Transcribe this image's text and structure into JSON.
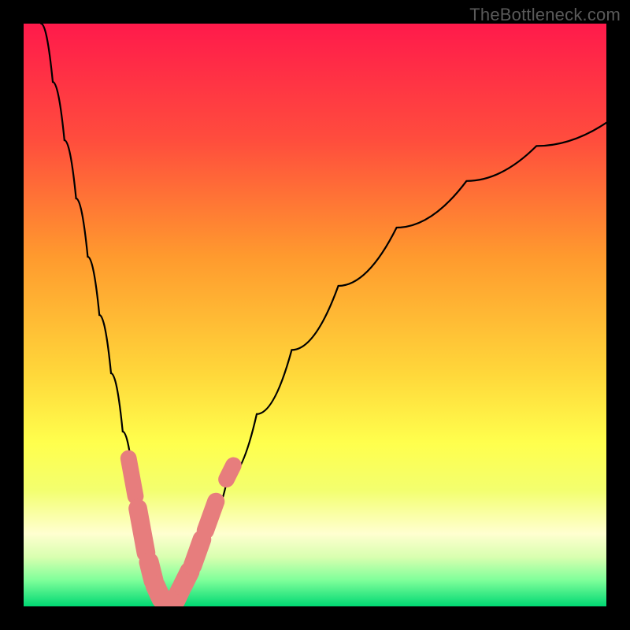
{
  "watermark": "TheBottleneck.com",
  "chart_data": {
    "type": "line",
    "title": "",
    "xlabel": "",
    "ylabel": "",
    "xlim": [
      0,
      100
    ],
    "ylim": [
      0,
      100
    ],
    "grid": false,
    "legend": false,
    "gradient_stops": [
      {
        "offset": 0.0,
        "color": "#ff1a4b"
      },
      {
        "offset": 0.2,
        "color": "#ff4d3d"
      },
      {
        "offset": 0.4,
        "color": "#ff9a2e"
      },
      {
        "offset": 0.6,
        "color": "#ffd73a"
      },
      {
        "offset": 0.72,
        "color": "#ffff4d"
      },
      {
        "offset": 0.8,
        "color": "#f3ff6e"
      },
      {
        "offset": 0.875,
        "color": "#ffffd0"
      },
      {
        "offset": 0.915,
        "color": "#d9ffb0"
      },
      {
        "offset": 0.955,
        "color": "#7fff9a"
      },
      {
        "offset": 1.0,
        "color": "#00d873"
      }
    ],
    "series": [
      {
        "name": "left-curve",
        "x": [
          3,
          5,
          7,
          9,
          11,
          13,
          15,
          17,
          19,
          20.5,
          22,
          23,
          24,
          25
        ],
        "y": [
          100,
          90,
          80,
          70,
          60,
          50,
          40,
          30,
          20,
          12,
          6,
          3,
          1,
          0
        ]
      },
      {
        "name": "right-curve",
        "x": [
          25,
          26,
          27,
          28.5,
          30,
          32,
          35,
          40,
          46,
          54,
          64,
          76,
          88,
          100
        ],
        "y": [
          0,
          1,
          3,
          6,
          10,
          15,
          22,
          33,
          44,
          55,
          65,
          73,
          79,
          83
        ]
      }
    ],
    "markers": [
      {
        "name": "left-markers",
        "strokes": [
          {
            "x1": 18.0,
            "y1": 25.4,
            "x2": 19.2,
            "y2": 18.9,
            "w": 2.8
          },
          {
            "x1": 19.6,
            "y1": 16.8,
            "x2": 21.0,
            "y2": 9.2,
            "w": 3.2
          },
          {
            "x1": 21.5,
            "y1": 7.6,
            "x2": 22.3,
            "y2": 4.4,
            "w": 3.4
          },
          {
            "x1": 22.6,
            "y1": 3.6,
            "x2": 23.4,
            "y2": 1.8,
            "w": 3.4
          },
          {
            "x1": 23.7,
            "y1": 1.4,
            "x2": 25.0,
            "y2": 0.0,
            "w": 3.6
          }
        ]
      },
      {
        "name": "right-markers",
        "strokes": [
          {
            "x1": 25.0,
            "y1": 0.0,
            "x2": 25.8,
            "y2": 0.8,
            "w": 3.6
          },
          {
            "x1": 26.1,
            "y1": 1.1,
            "x2": 27.0,
            "y2": 3.0,
            "w": 3.4
          },
          {
            "x1": 27.3,
            "y1": 3.6,
            "x2": 28.5,
            "y2": 6.0,
            "w": 3.4
          },
          {
            "x1": 29.0,
            "y1": 7.0,
            "x2": 30.6,
            "y2": 11.5,
            "w": 3.2
          },
          {
            "x1": 31.2,
            "y1": 13.0,
            "x2": 33.0,
            "y2": 18.0,
            "w": 3.0
          },
          {
            "x1": 34.8,
            "y1": 21.8,
            "x2": 36.0,
            "y2": 24.2,
            "w": 2.8
          }
        ]
      }
    ],
    "marker_color": "#e77d7d"
  }
}
